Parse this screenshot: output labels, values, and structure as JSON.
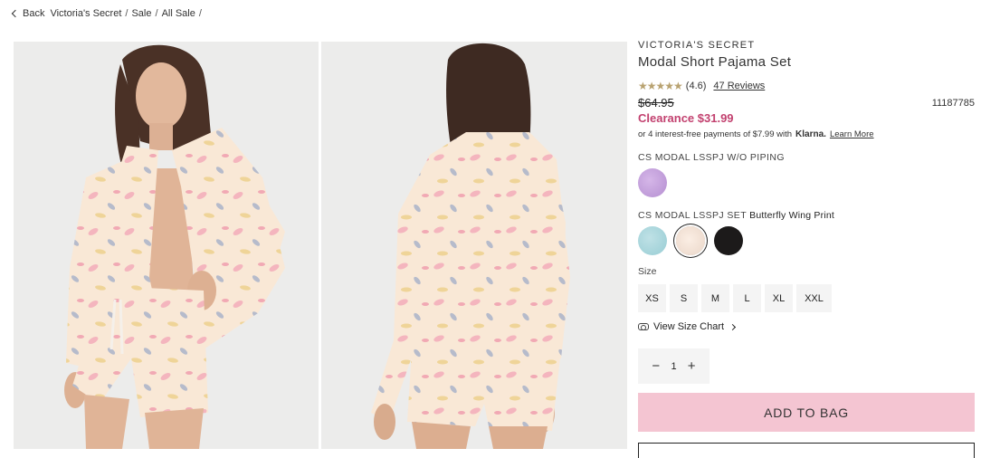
{
  "breadcrumb": {
    "back_label": "Back",
    "items": [
      "Victoria's Secret",
      "Sale",
      "All Sale"
    ],
    "separator": "/"
  },
  "product": {
    "brand": "VICTORIA'S SECRET",
    "title": "Modal Short Pajama Set",
    "stars": "★★★★★",
    "rating_text": "(4.6)",
    "reviews_link": "47 Reviews",
    "original_price": "$64.95",
    "sku": "11187785",
    "clearance_price": "Clearance $31.99",
    "klarna_text": "or 4 interest-free payments of $7.99 with",
    "klarna_brand": "Klarna.",
    "klarna_learn_more": "Learn More"
  },
  "colors": {
    "group1_label": "CS MODAL LSSPJ W/O PIPING",
    "group2_label": "CS MODAL LSSPJ SET",
    "group2_selected": "Butterfly Wing Print",
    "accent_pink": "#f4c5d2",
    "clearance_red": "#c2416f"
  },
  "sizes": {
    "label": "Size",
    "options": [
      "XS",
      "S",
      "M",
      "L",
      "XL",
      "XXL"
    ],
    "size_chart_link": "View Size Chart"
  },
  "quantity": {
    "minus": "−",
    "value": "1",
    "plus": "+"
  },
  "actions": {
    "add_to_bag": "ADD TO BAG"
  }
}
